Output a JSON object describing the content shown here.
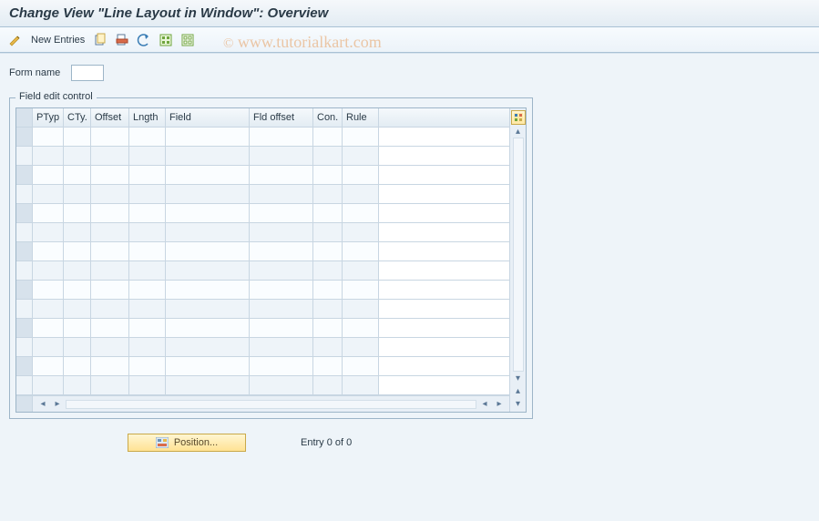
{
  "title": "Change View \"Line Layout in Window\": Overview",
  "toolbar": {
    "new_entries": "New Entries"
  },
  "watermark": "www.tutorialkart.com",
  "form": {
    "name_label": "Form name",
    "name_value": ""
  },
  "group": {
    "title": "Field edit control"
  },
  "table": {
    "columns": {
      "ptyp": "PTyp",
      "cty": "CTy.",
      "offset": "Offset",
      "lngth": "Lngth",
      "field": "Field",
      "fld_offset": "Fld offset",
      "con": "Con.",
      "rule": "Rule"
    },
    "rows": [
      "",
      "",
      "",
      "",
      "",
      "",
      "",
      "",
      "",
      "",
      "",
      "",
      "",
      ""
    ]
  },
  "footer": {
    "position_label": "Position...",
    "entry_text": "Entry 0 of 0"
  }
}
